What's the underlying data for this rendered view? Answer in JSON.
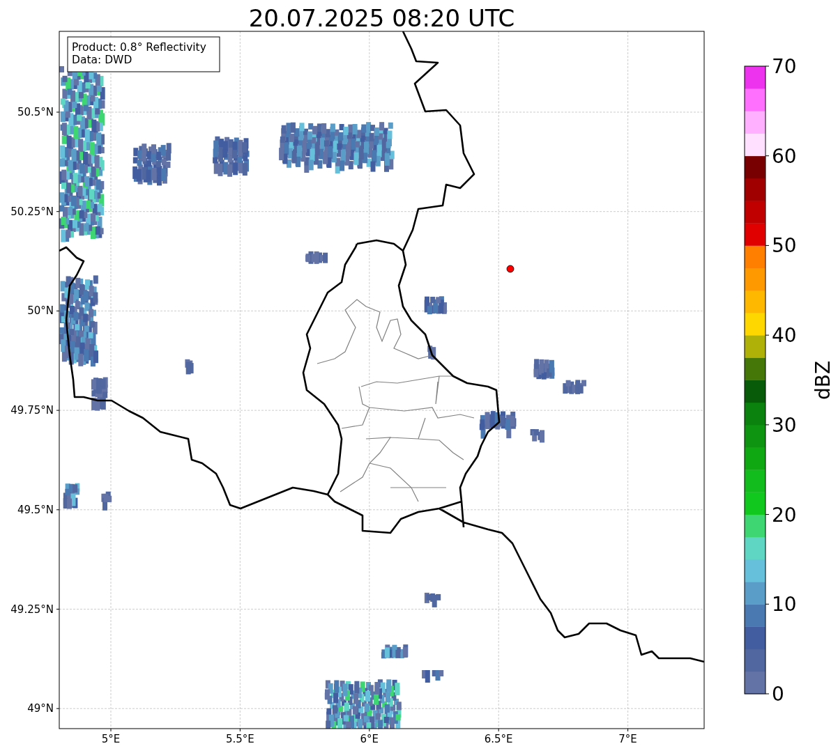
{
  "title": "20.07.2025 08:20 UTC",
  "legend": [
    "Product: 0.8° Reflectivity",
    "Data: DWD"
  ],
  "xticks": [
    "5°E",
    "5.5°E",
    "6°E",
    "6.5°E",
    "7°E"
  ],
  "yticks": [
    "50.5°N",
    "50.25°N",
    "50°N",
    "49.75°N",
    "49.5°N",
    "49.25°N",
    "49°N"
  ],
  "colorbar": {
    "label": "dBZ",
    "ticks": [
      "70",
      "60",
      "50",
      "40",
      "30",
      "20",
      "10",
      "0"
    ],
    "bins": [
      {
        "color": "#6473a6"
      },
      {
        "color": "#51679f"
      },
      {
        "color": "#435ea0"
      },
      {
        "color": "#4a78b0"
      },
      {
        "color": "#5a9dc8"
      },
      {
        "color": "#66c0dc"
      },
      {
        "color": "#5fd6c4"
      },
      {
        "color": "#3ed672"
      },
      {
        "color": "#11c81e"
      },
      {
        "color": "#12bc1c"
      },
      {
        "color": "#10a812"
      },
      {
        "color": "#0e9410"
      },
      {
        "color": "#0b820d"
      },
      {
        "color": "#085c09"
      },
      {
        "color": "#447708"
      },
      {
        "color": "#b0b108"
      },
      {
        "color": "#ffd700"
      },
      {
        "color": "#ffb800"
      },
      {
        "color": "#ff9900"
      },
      {
        "color": "#ff7f00"
      },
      {
        "color": "#e00000"
      },
      {
        "color": "#c00000"
      },
      {
        "color": "#a00000"
      },
      {
        "color": "#780000"
      },
      {
        "color": "#ffe0ff"
      },
      {
        "color": "#ffb0ff"
      },
      {
        "color": "#ff70ff"
      },
      {
        "color": "#ee33ee"
      }
    ]
  }
}
